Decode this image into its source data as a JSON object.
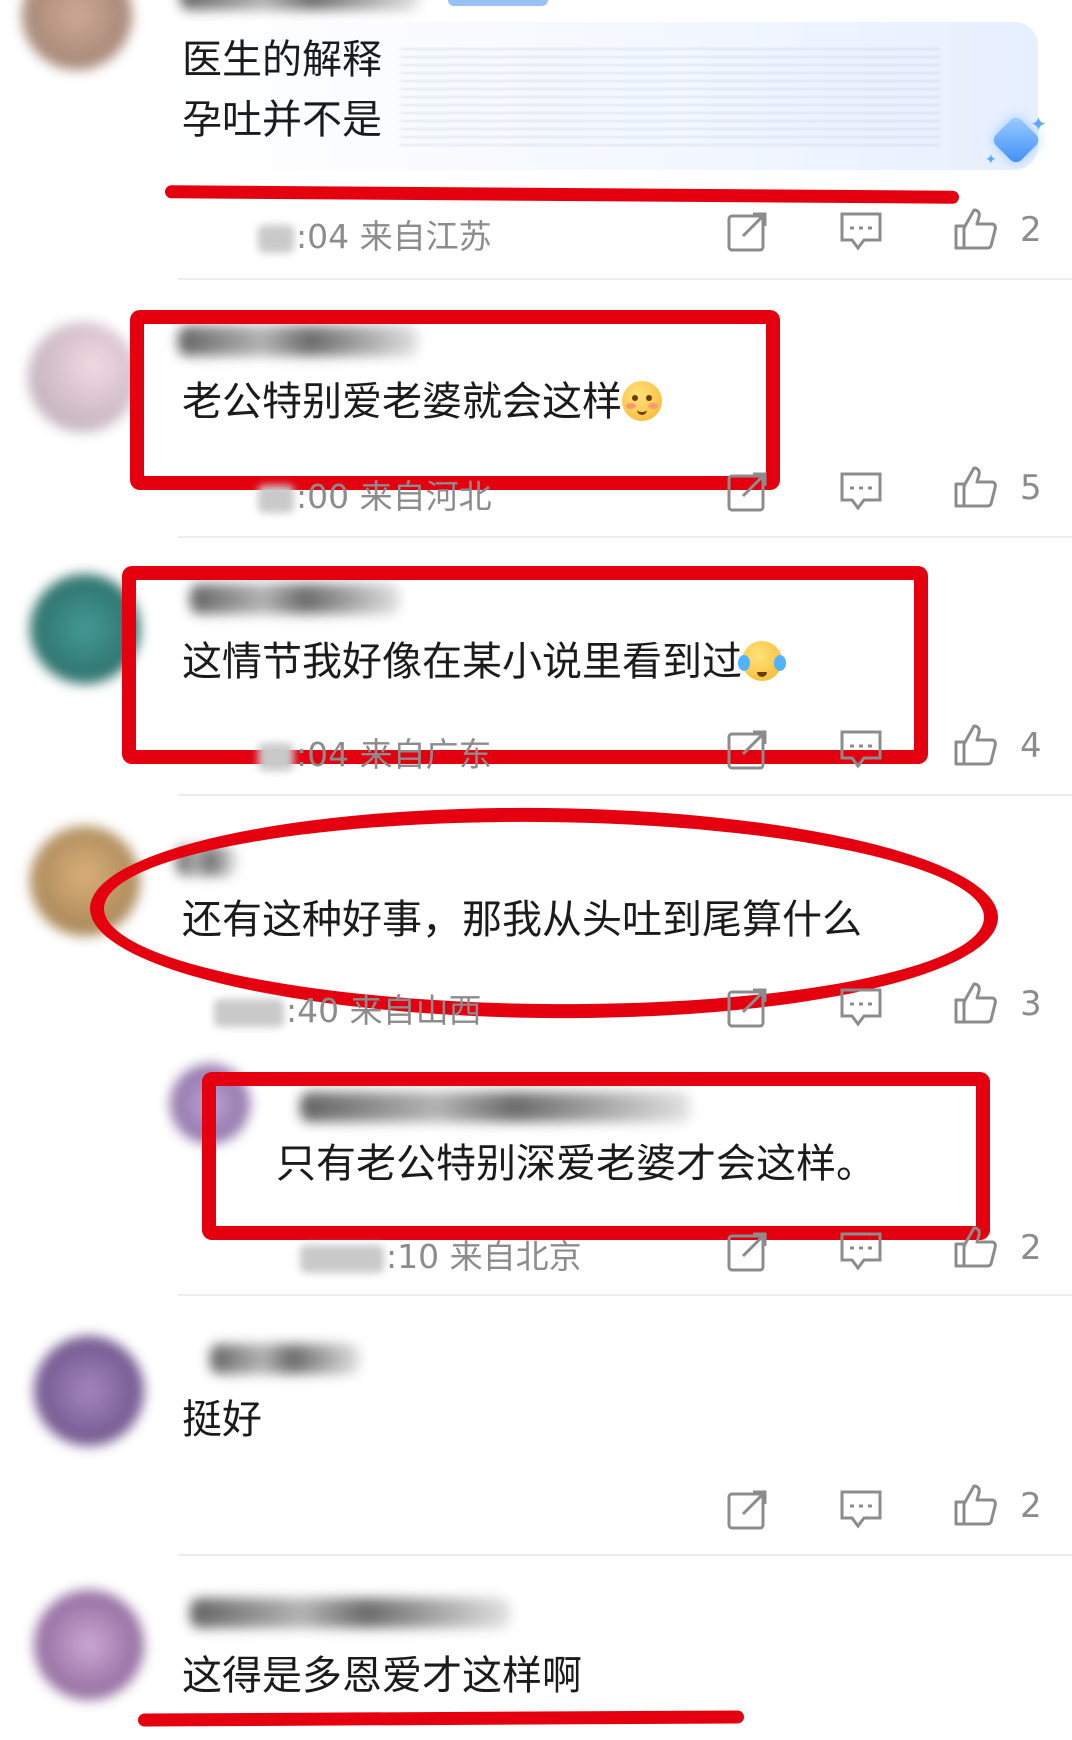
{
  "colors": {
    "annotation_red": "#e4000f",
    "meta_gray": "#8c8c8c",
    "text": "#1b1b1b",
    "divider": "#ececec"
  },
  "comments": [
    {
      "text_line1": "医生的解释",
      "text_line2": "孕吐并不是",
      "time": ":04",
      "location": "来自江苏",
      "likes": "2"
    },
    {
      "text": "老公特别爱老婆就会这样",
      "emoji": "blush-smile-emoji",
      "time": ":00",
      "location": "来自河北",
      "likes": "5"
    },
    {
      "text": "这情节我好像在某小说里看到过",
      "emoji": "laugh-tears-emoji",
      "time": ":04",
      "location": "来自广东",
      "likes": "4"
    },
    {
      "text": "还有这种好事，那我从头吐到尾算什么",
      "time": ":40",
      "location": "来自山西",
      "likes": "3"
    },
    {
      "text": "只有老公特别深爱老婆才会这样。",
      "time": ":10",
      "location": "来自北京",
      "likes": "2"
    },
    {
      "text": "挺好",
      "likes": "2"
    },
    {
      "text": "这得是多恩爱才这样啊"
    }
  ],
  "icons": {
    "share": "share-icon",
    "reply": "comment-icon",
    "like": "thumbs-up-icon"
  }
}
